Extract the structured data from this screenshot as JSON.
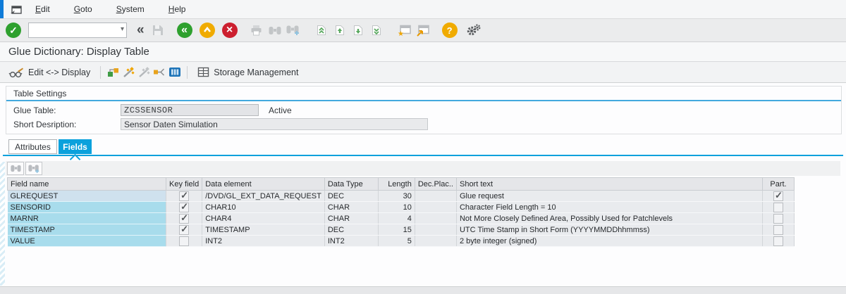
{
  "menu": {
    "items": [
      "Edit",
      "Goto",
      "System",
      "Help"
    ]
  },
  "toolbar": {
    "command_field_value": "",
    "icons": {
      "continue": "✓",
      "dropdown": "▾",
      "collapse": "«",
      "back": "«",
      "cancel": "×",
      "help": "?"
    }
  },
  "title": "Glue Dictionary: Display Table",
  "app_toolbar": {
    "edit_display_label": "Edit <-> Display",
    "storage_label": "Storage Management"
  },
  "table_settings": {
    "group_title": "Table Settings",
    "glue_table_label": "Glue Table:",
    "glue_table_value": "ZCSSENSOR",
    "status_text": "Active",
    "short_desc_label": "Short Desription:",
    "short_desc_value": "Sensor Daten Simulation"
  },
  "tabs": {
    "attributes": "Attributes",
    "fields": "Fields"
  },
  "fields_table": {
    "columns": [
      "Field name",
      "Key field",
      "Data element",
      "Data Type",
      "Length",
      "Dec.Plac..",
      "Short text",
      "Part."
    ],
    "rows": [
      {
        "field_name": "GLREQUEST",
        "key": true,
        "data_element": "/DVD/GL_EXT_DATA_REQUEST",
        "data_type": "DEC",
        "length": "30",
        "dec": "",
        "short_text": "Glue request",
        "part": true
      },
      {
        "field_name": "SENSORID",
        "key": true,
        "data_element": "CHAR10",
        "data_type": "CHAR",
        "length": "10",
        "dec": "",
        "short_text": "Character Field Length = 10",
        "part": false
      },
      {
        "field_name": "MARNR",
        "key": true,
        "data_element": "CHAR4",
        "data_type": "CHAR",
        "length": "4",
        "dec": "",
        "short_text": "Not More Closely Defined Area, Possibly Used for Patchlevels",
        "part": false
      },
      {
        "field_name": "TIMESTAMP",
        "key": true,
        "data_element": "TIMESTAMP",
        "data_type": "DEC",
        "length": "15",
        "dec": "",
        "short_text": "UTC Time Stamp in Short Form (YYYYMMDDhhmmss)",
        "part": false
      },
      {
        "field_name": "VALUE",
        "key": false,
        "data_element": "INT2",
        "data_type": "INT2",
        "length": "5",
        "dec": "",
        "short_text": "2 byte integer (signed)",
        "part": false
      }
    ]
  },
  "colors": {
    "accent_blue": "#0f7bd8",
    "tab_active_blue": "#0ba1dc",
    "lead_cell_cyan": "#a8dcec",
    "lead_cell_selected": "#cfe1ee",
    "continue_green": "#2ea02e",
    "exit_amber": "#f0ab00",
    "cancel_red": "#cc1f2f",
    "disabled_gray": "#c2c5c7"
  }
}
